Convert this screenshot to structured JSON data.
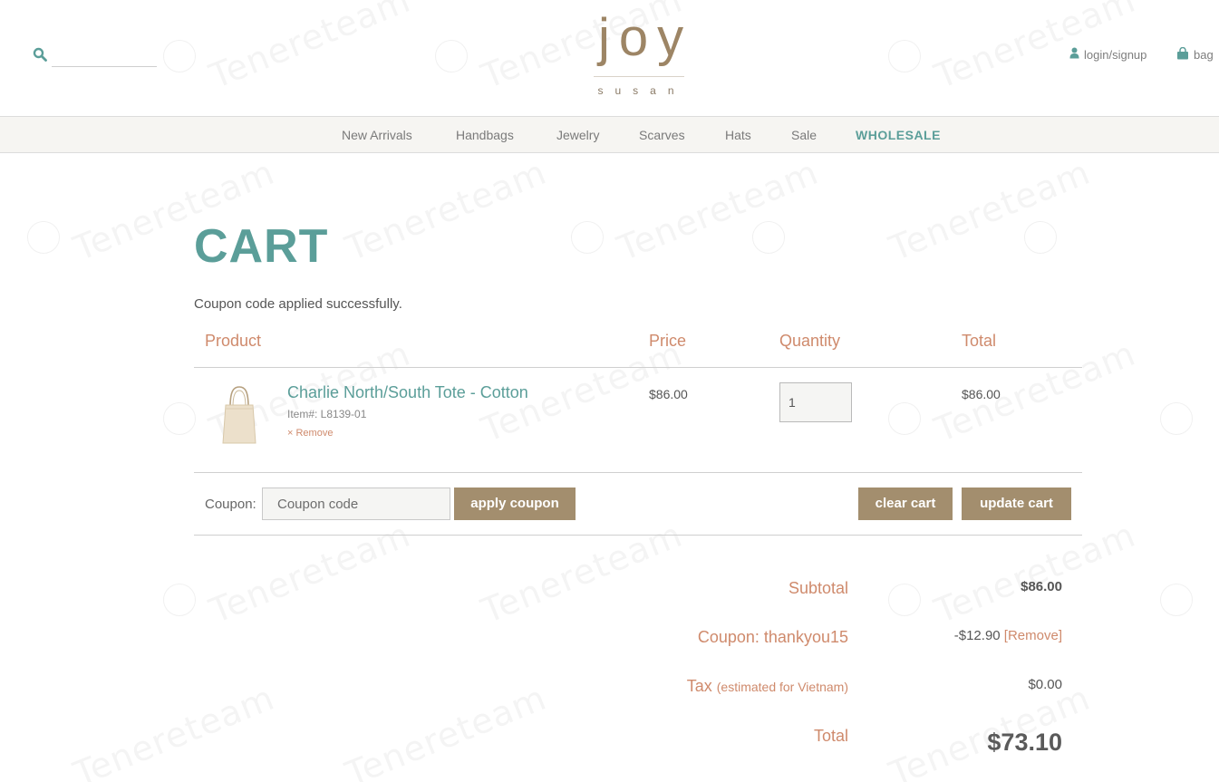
{
  "header": {
    "search": {
      "placeholder": ""
    },
    "logo": {
      "main": "joy",
      "sub": "susan"
    },
    "login_label": "login/signup",
    "bag_label": "bag"
  },
  "nav": {
    "items": [
      {
        "label": "New Arrivals"
      },
      {
        "label": "Handbags"
      },
      {
        "label": "Jewelry"
      },
      {
        "label": "Scarves"
      },
      {
        "label": "Hats"
      },
      {
        "label": "Sale"
      },
      {
        "label": "WHOLESALE"
      }
    ]
  },
  "cart": {
    "title": "CART",
    "notice": "Coupon code applied successfully.",
    "columns": {
      "product": "Product",
      "price": "Price",
      "quantity": "Quantity",
      "total": "Total"
    },
    "items": [
      {
        "name": "Charlie North/South Tote - Cotton",
        "sku": "Item#: L8139-01",
        "remove": "× Remove",
        "price": "$86.00",
        "quantity": "1",
        "total": "$86.00"
      }
    ],
    "coupon": {
      "label": "Coupon:",
      "placeholder": "Coupon code",
      "apply_label": "apply coupon"
    },
    "clear_label": "clear cart",
    "update_label": "update cart"
  },
  "summary": {
    "subtotal_label": "Subtotal",
    "subtotal_value": "$86.00",
    "coupon_label": "Coupon: thankyou15",
    "coupon_value": "-$12.90",
    "coupon_remove": "[Remove]",
    "tax_label": "Tax",
    "tax_note": "(estimated for Vietnam)",
    "tax_value": "$0.00",
    "total_label": "Total",
    "total_value": "$73.10"
  },
  "watermark": {
    "text": "Tenereteam"
  },
  "colors": {
    "teal": "#5b9e99",
    "tan": "#a38e6e",
    "salmon": "#cf8a6c",
    "logo_brown": "#9d8565"
  },
  "icons": {
    "search": "search-icon",
    "user": "user-icon",
    "bag": "shopping-bag-icon"
  }
}
